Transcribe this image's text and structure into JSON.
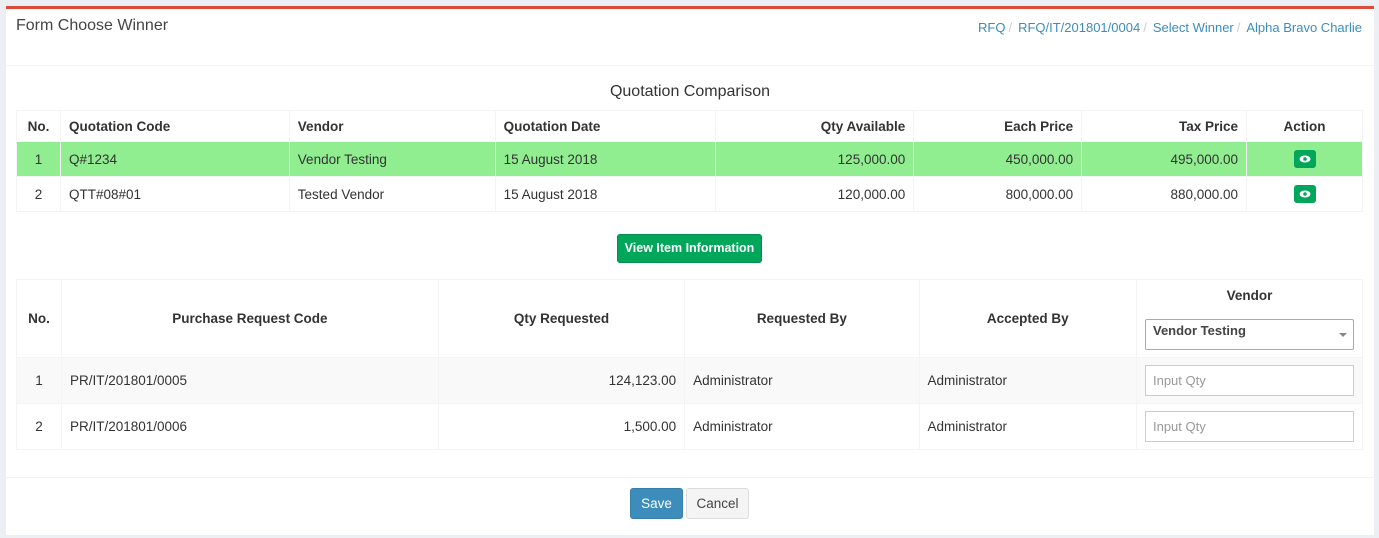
{
  "header": {
    "title": "Form Choose Winner",
    "breadcrumb": [
      "RFQ",
      "RFQ/IT/201801/0004",
      "Select Winner",
      "Alpha Bravo Charlie"
    ]
  },
  "quotation": {
    "title": "Quotation Comparison",
    "columns": [
      "No.",
      "Quotation Code",
      "Vendor",
      "Quotation Date",
      "Qty Available",
      "Each Price",
      "Tax Price",
      "Action"
    ],
    "rows": [
      {
        "no": "1",
        "code": "Q#1234",
        "vendor": "Vendor Testing",
        "date": "15 August 2018",
        "qty": "125,000.00",
        "price": "450,000.00",
        "tax": "495,000.00",
        "selected": true
      },
      {
        "no": "2",
        "code": "QTT#08#01",
        "vendor": "Tested Vendor",
        "date": "15 August 2018",
        "qty": "120,000.00",
        "price": "800,000.00",
        "tax": "880,000.00",
        "selected": false
      }
    ],
    "selected_color": "#90ee90",
    "action_icon": "eye-icon"
  },
  "view_item_button": "View Item Information",
  "items": {
    "columns": [
      "No.",
      "Purchase Request Code",
      "Qty Requested",
      "Requested By",
      "Accepted By",
      "Vendor"
    ],
    "vendor_select": "Vendor Testing",
    "qty_placeholder": "Input Qty",
    "rows": [
      {
        "no": "1",
        "code": "PR/IT/201801/0005",
        "qty": "124,123.00",
        "requested_by": "Administrator",
        "accepted_by": "Administrator"
      },
      {
        "no": "2",
        "code": "PR/IT/201801/0006",
        "qty": "1,500.00",
        "requested_by": "Administrator",
        "accepted_by": "Administrator"
      }
    ]
  },
  "footer": {
    "save_label": "Save",
    "cancel_label": "Cancel"
  },
  "colors": {
    "accent_top": "#dd4b39",
    "link": "#3c8dbc",
    "success": "#00a65a",
    "primary": "#3c8dbc"
  }
}
